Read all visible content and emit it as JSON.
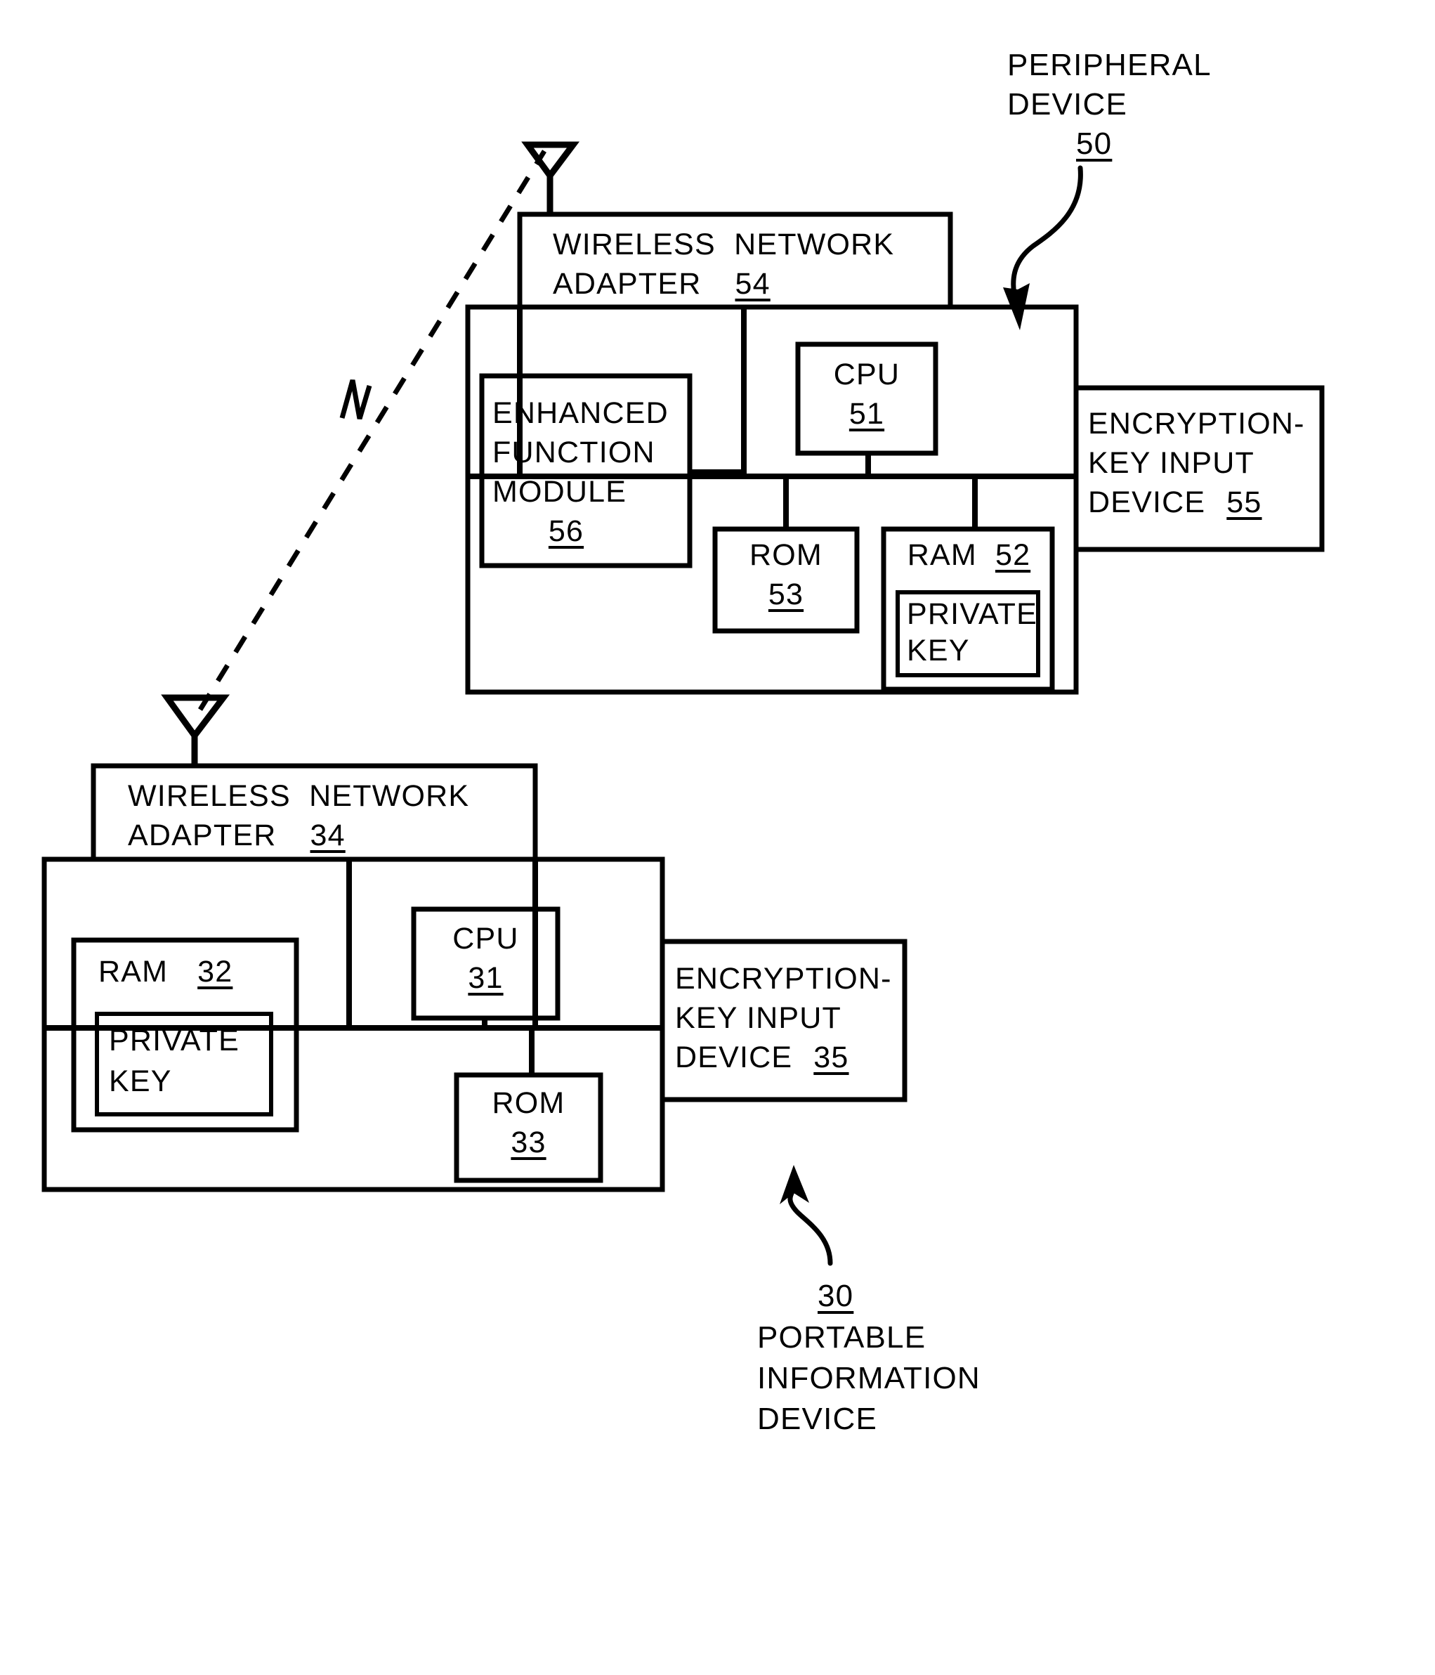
{
  "figure": {
    "type": "patent-block-diagram",
    "background_color": "#ffffff",
    "line_color": "#000000"
  },
  "peripheral_device": {
    "callout": {
      "line1": "PERIPHERAL",
      "line2": "DEVICE",
      "ref": "50"
    },
    "antenna": {
      "icon": "antenna-icon"
    },
    "wireless_adapter": {
      "line1": "WIRELESS  NETWORK",
      "line2": "ADAPTER",
      "ref": "54"
    },
    "enhanced_function_module": {
      "line1": "ENHANCED",
      "line2": "FUNCTION",
      "line3": "MODULE",
      "ref": "56"
    },
    "cpu": {
      "label": "CPU",
      "ref": "51"
    },
    "rom": {
      "label": "ROM",
      "ref": "53"
    },
    "ram": {
      "label": "RAM",
      "ref": "52",
      "private_key": {
        "line1": "PRIVATE",
        "line2": "KEY"
      }
    },
    "encryption_key_input_device": {
      "line1": "ENCRYPTION-",
      "line2": "KEY INPUT",
      "line3": "DEVICE",
      "ref": "55"
    }
  },
  "portable_information_device": {
    "callout": {
      "ref": "30",
      "line1": "PORTABLE",
      "line2": "INFORMATION",
      "line3": "DEVICE"
    },
    "antenna": {
      "icon": "antenna-icon"
    },
    "wireless_adapter": {
      "line1": "WIRELESS  NETWORK",
      "line2": "ADAPTER",
      "ref": "34"
    },
    "ram": {
      "label": "RAM",
      "ref": "32",
      "private_key": {
        "line1": "PRIVATE",
        "line2": "KEY"
      }
    },
    "cpu": {
      "label": "CPU",
      "ref": "31"
    },
    "rom": {
      "label": "ROM",
      "ref": "33"
    },
    "encryption_key_input_device": {
      "line1": "ENCRYPTION-",
      "line2": "KEY INPUT",
      "line3": "DEVICE",
      "ref": "35"
    }
  },
  "wireless_link": {
    "style": "dashed",
    "break_symbol": true
  }
}
